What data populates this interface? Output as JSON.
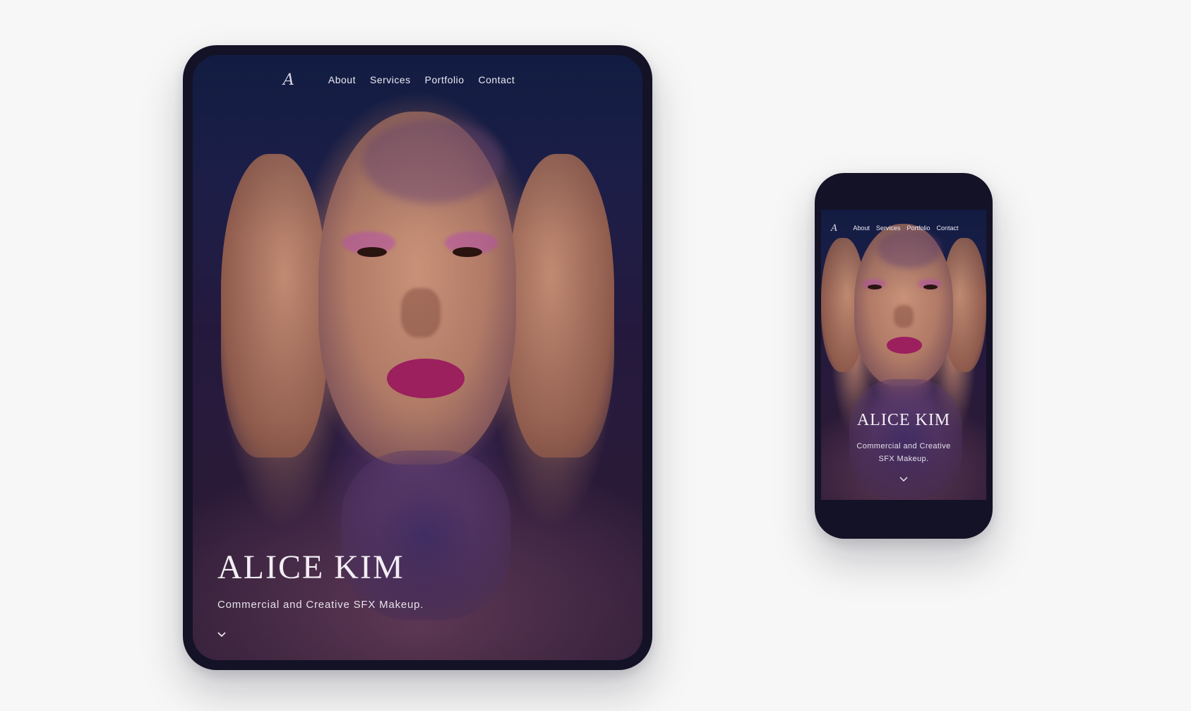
{
  "site": {
    "logo_text": "A",
    "nav": [
      "About",
      "Services",
      "Portfolio",
      "Contact"
    ]
  },
  "tablet": {
    "title": "ALICE KIM",
    "subtitle": "Commercial and Creative SFX Makeup."
  },
  "phone": {
    "title": "ALICE KIM",
    "subtitle_line1": "Commercial and Creative",
    "subtitle_line2": "SFX Makeup."
  },
  "colors": {
    "page_background": "#f7f7f7",
    "device_frame": "#141226",
    "text_light": "#f3eef4",
    "lip_accent": "#9c1f5e"
  },
  "icons": {
    "scroll": "chevron-down-icon",
    "logo": "signature-logo-icon"
  }
}
